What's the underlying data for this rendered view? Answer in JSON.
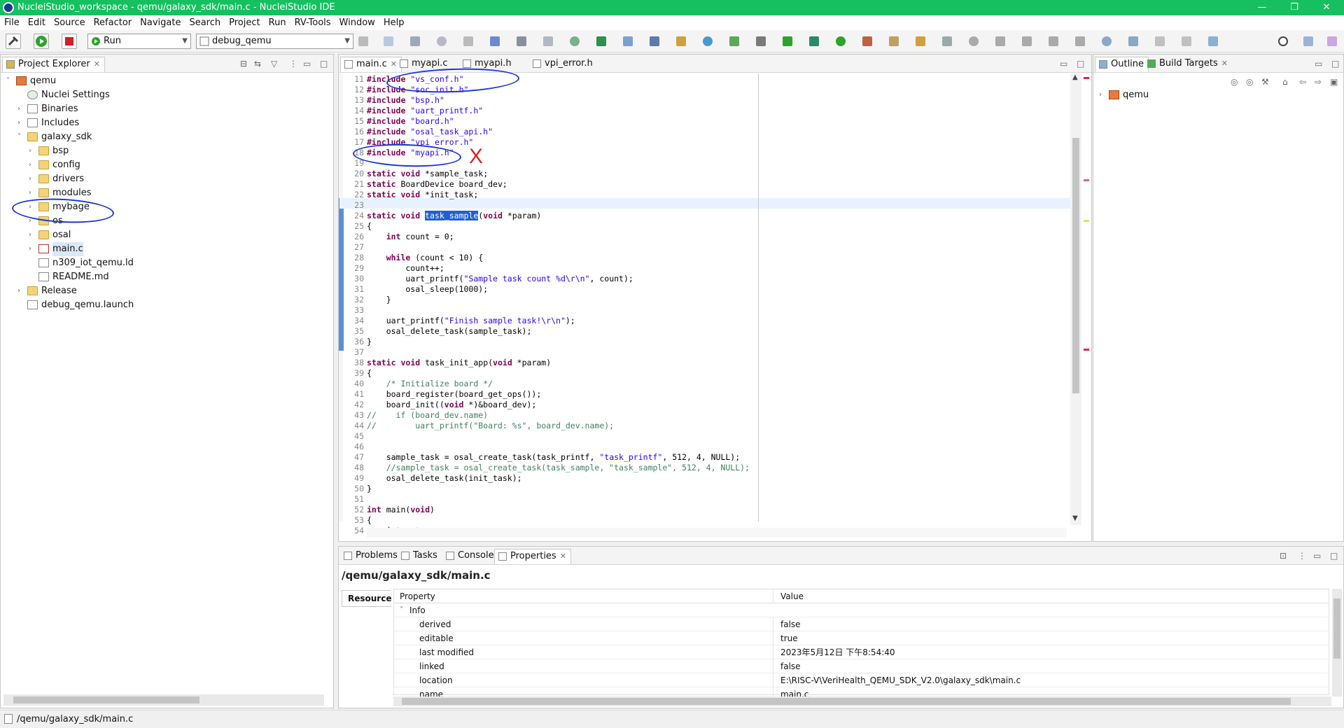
{
  "window": {
    "title": "NucleiStudio_workspace - qemu/galaxy_sdk/main.c - NucleiStudio IDE",
    "controls": [
      "—",
      "❐",
      "✕"
    ]
  },
  "menu": [
    "File",
    "Edit",
    "Source",
    "Refactor",
    "Navigate",
    "Search",
    "Project",
    "Run",
    "RV-Tools",
    "Window",
    "Help"
  ],
  "toolbar": {
    "run_mode": "Run",
    "launch_config": "debug_qemu"
  },
  "project_explorer": {
    "title": "Project Explorer",
    "tree": [
      {
        "label": "qemu",
        "indent": 0,
        "icon": "project-icon",
        "twisty": "expanded"
      },
      {
        "label": "Nuclei Settings",
        "indent": 1,
        "icon": "settings-icon",
        "twisty": ""
      },
      {
        "label": "Binaries",
        "indent": 1,
        "icon": "binaries-icon",
        "twisty": "collapsed"
      },
      {
        "label": "Includes",
        "indent": 1,
        "icon": "includes-icon",
        "twisty": "collapsed"
      },
      {
        "label": "galaxy_sdk",
        "indent": 1,
        "icon": "folder-icon",
        "twisty": "expanded"
      },
      {
        "label": "bsp",
        "indent": 2,
        "icon": "folder-icon",
        "twisty": "collapsed"
      },
      {
        "label": "config",
        "indent": 2,
        "icon": "folder-icon",
        "twisty": "collapsed"
      },
      {
        "label": "drivers",
        "indent": 2,
        "icon": "folder-icon",
        "twisty": "collapsed"
      },
      {
        "label": "modules",
        "indent": 2,
        "icon": "folder-icon",
        "twisty": "collapsed"
      },
      {
        "label": "mybage",
        "indent": 2,
        "icon": "folder-icon",
        "twisty": "collapsed"
      },
      {
        "label": "os",
        "indent": 2,
        "icon": "folder-icon",
        "twisty": "collapsed"
      },
      {
        "label": "osal",
        "indent": 2,
        "icon": "folder-icon",
        "twisty": "collapsed"
      },
      {
        "label": "main.c",
        "indent": 2,
        "icon": "c-file-icon",
        "twisty": "collapsed"
      },
      {
        "label": "n309_iot_qemu.ld",
        "indent": 2,
        "icon": "file-icon",
        "twisty": ""
      },
      {
        "label": "README.md",
        "indent": 2,
        "icon": "file-icon",
        "twisty": ""
      },
      {
        "label": "Release",
        "indent": 1,
        "icon": "folder-icon",
        "twisty": "collapsed"
      },
      {
        "label": "debug_qemu.launch",
        "indent": 1,
        "icon": "launch-file-icon",
        "twisty": ""
      }
    ]
  },
  "editor": {
    "tabs": [
      "main.c",
      "myapi.c",
      "myapi.h",
      "vpi_error.h"
    ],
    "active_tab": "main.c",
    "first_line": 11,
    "lines": [
      "#include \"vs_conf.h\"",
      "#include \"soc_init.h\"",
      "#include \"bsp.h\"",
      "#include \"uart_printf.h\"",
      "#include \"board.h\"",
      "#include \"osal_task_api.h\"",
      "#include \"vpi_error.h\"",
      "#include \"myapi.h\"",
      "",
      "static void *sample_task;",
      "static BoardDevice board_dev;",
      "static void *init_task;",
      "",
      "static void task_sample(void *param)",
      "{",
      "    int count = 0;",
      "",
      "    while (count < 10) {",
      "        count++;",
      "        uart_printf(\"Sample task count %d\\r\\n\", count);",
      "        osal_sleep(1000);",
      "    }",
      "",
      "    uart_printf(\"Finish sample task!\\r\\n\");",
      "    osal_delete_task(sample_task);",
      "}",
      "",
      "static void task_init_app(void *param)",
      "{",
      "    /* Initialize board */",
      "    board_register(board_get_ops());",
      "    board_init((void *)&board_dev);",
      "//    if (board_dev.name)",
      "//        uart_printf(\"Board: %s\", board_dev.name);",
      "",
      "",
      "    sample_task = osal_create_task(task_printf, \"task_printf\", 512, 4, NULL);",
      "    //sample_task = osal_create_task(task_sample, \"task_sample\", 512, 4, NULL);",
      "    osal_delete_task(init_task);",
      "}",
      "",
      "int main(void)",
      "{",
      "    int ret;"
    ]
  },
  "outline": {
    "tabs": [
      "Outline",
      "Build Targets"
    ],
    "tree": [
      "qemu"
    ]
  },
  "bottom": {
    "tabs": [
      "Problems",
      "Tasks",
      "Console",
      "Properties"
    ],
    "path": "/qemu/galaxy_sdk/main.c",
    "resource_tab": "Resource",
    "col_property": "Property",
    "col_value": "Value",
    "group": "Info",
    "rows": [
      {
        "name": "derived",
        "value": "false"
      },
      {
        "name": "editable",
        "value": "true"
      },
      {
        "name": "last modified",
        "value": "2023年5月12日 下午8:54:40"
      },
      {
        "name": "linked",
        "value": "false"
      },
      {
        "name": "location",
        "value": "E:\\RISC-V\\VeriHealth_QEMU_SDK_V2.0\\galaxy_sdk\\main.c"
      },
      {
        "name": "name",
        "value": "main.c"
      }
    ]
  },
  "status": {
    "path": "/qemu/galaxy_sdk/main.c"
  },
  "annotations": {
    "red_x": "X"
  },
  "colors": {
    "titlebar": "#16c060",
    "ink": "#1736d6",
    "selection": "#2060d0"
  }
}
